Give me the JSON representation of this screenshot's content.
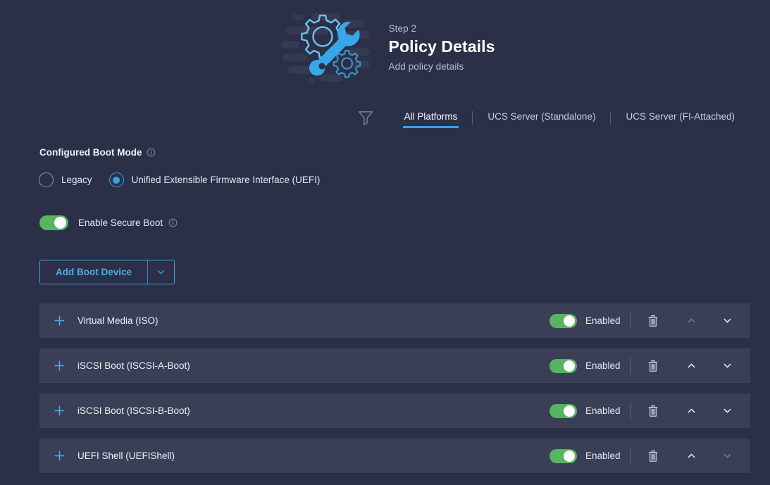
{
  "header": {
    "step_label": "Step 2",
    "title": "Policy Details",
    "subtitle": "Add policy details",
    "illustration_icon": "gear-wrench-illustration"
  },
  "toolbar": {
    "filter_icon": "filter-funnel-icon",
    "tabs": [
      {
        "label": "All Platforms",
        "active": true
      },
      {
        "label": "UCS Server (Standalone)",
        "active": false
      },
      {
        "label": "UCS Server (FI-Attached)",
        "active": false
      }
    ]
  },
  "boot_mode": {
    "label": "Configured Boot Mode",
    "info_icon": "info-circle-icon",
    "options": [
      {
        "label": "Legacy",
        "selected": false
      },
      {
        "label": "Unified Extensible Firmware Interface (UEFI)",
        "selected": true
      }
    ]
  },
  "secure_boot": {
    "label": "Enable Secure Boot",
    "info_icon": "info-circle-icon",
    "enabled": true
  },
  "add_boot_device": {
    "label": "Add Boot Device",
    "caret_icon": "chevron-down-icon"
  },
  "device_row_icons": {
    "expand_icon": "plus-icon",
    "delete_icon": "trash-icon",
    "move_up_icon": "chevron-up-icon",
    "move_down_icon": "chevron-down-icon"
  },
  "boot_devices": [
    {
      "name": "Virtual Media (ISO)",
      "state": "Enabled",
      "enabled": true,
      "can_move_up": false,
      "can_move_down": true
    },
    {
      "name": "iSCSI Boot (ISCSI-A-Boot)",
      "state": "Enabled",
      "enabled": true,
      "can_move_up": true,
      "can_move_down": true
    },
    {
      "name": "iSCSI Boot (ISCSI-B-Boot)",
      "state": "Enabled",
      "enabled": true,
      "can_move_up": true,
      "can_move_down": true
    },
    {
      "name": "UEFI Shell (UEFIShell)",
      "state": "Enabled",
      "enabled": true,
      "can_move_up": true,
      "can_move_down": false
    }
  ],
  "colors": {
    "page_background": "#2b3048",
    "row_background": "#3a3f57",
    "accent_blue": "#3ba2e0",
    "toggle_green": "#57b45f",
    "text_primary": "#eef1f6",
    "text_muted": "#b6bdcd"
  }
}
